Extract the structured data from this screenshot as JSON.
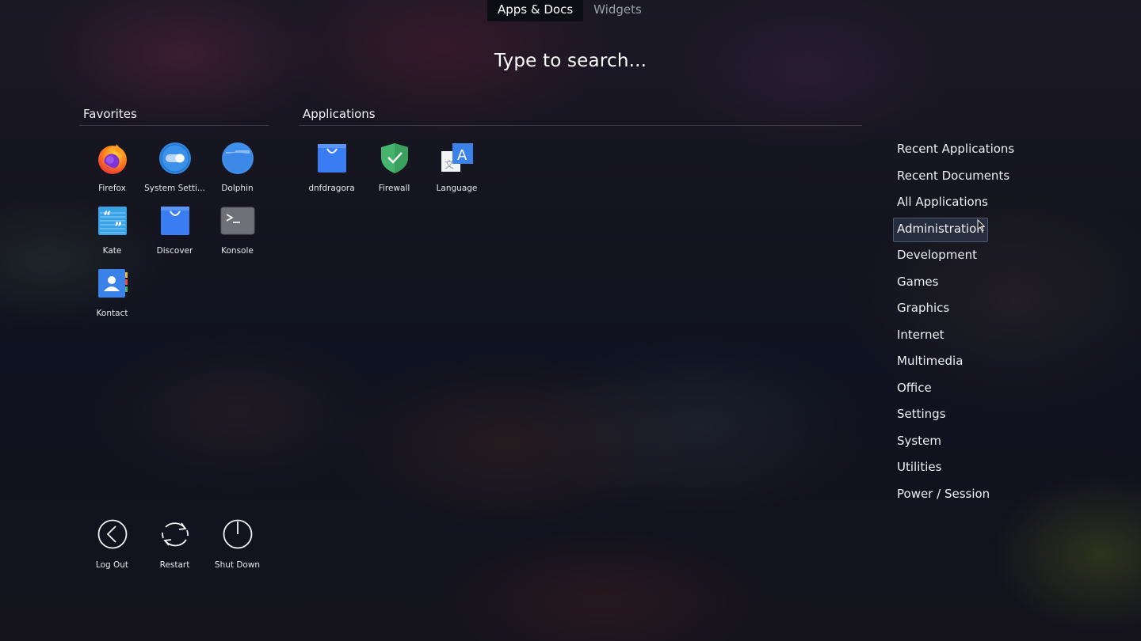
{
  "tabs": [
    {
      "label": "Apps & Docs",
      "active": true
    },
    {
      "label": "Widgets",
      "active": false
    }
  ],
  "search": {
    "placeholder": "Type to search..."
  },
  "favorites": {
    "title": "Favorites",
    "items": [
      {
        "label": "Firefox",
        "icon": "firefox-icon"
      },
      {
        "label": "System Setti...",
        "icon": "system-settings-icon"
      },
      {
        "label": "Dolphin",
        "icon": "dolphin-folder-icon"
      },
      {
        "label": "Kate",
        "icon": "kate-editor-icon"
      },
      {
        "label": "Discover",
        "icon": "discover-bag-icon"
      },
      {
        "label": "Konsole",
        "icon": "terminal-icon"
      },
      {
        "label": "Kontact",
        "icon": "contacts-icon"
      }
    ]
  },
  "applications": {
    "title": "Applications",
    "items": [
      {
        "label": "dnfdragora",
        "icon": "shopping-bag-icon"
      },
      {
        "label": "Firewall",
        "icon": "shield-check-icon"
      },
      {
        "label": "Language",
        "icon": "language-icon"
      }
    ]
  },
  "categories": [
    "Recent Applications",
    "Recent Documents",
    "All Applications",
    "Administration",
    "Development",
    "Games",
    "Graphics",
    "Internet",
    "Multimedia",
    "Office",
    "Settings",
    "System",
    "Utilities",
    "Power / Session"
  ],
  "power": [
    {
      "label": "Log Out",
      "icon": "logout-icon"
    },
    {
      "label": "Restart",
      "icon": "restart-icon"
    },
    {
      "label": "Shut Down",
      "icon": "power-icon"
    }
  ],
  "colors": {
    "accent_blue": "#3d7cf0",
    "firewall_green": "#45b36b",
    "active_tab_bg": "#0d0d14"
  }
}
